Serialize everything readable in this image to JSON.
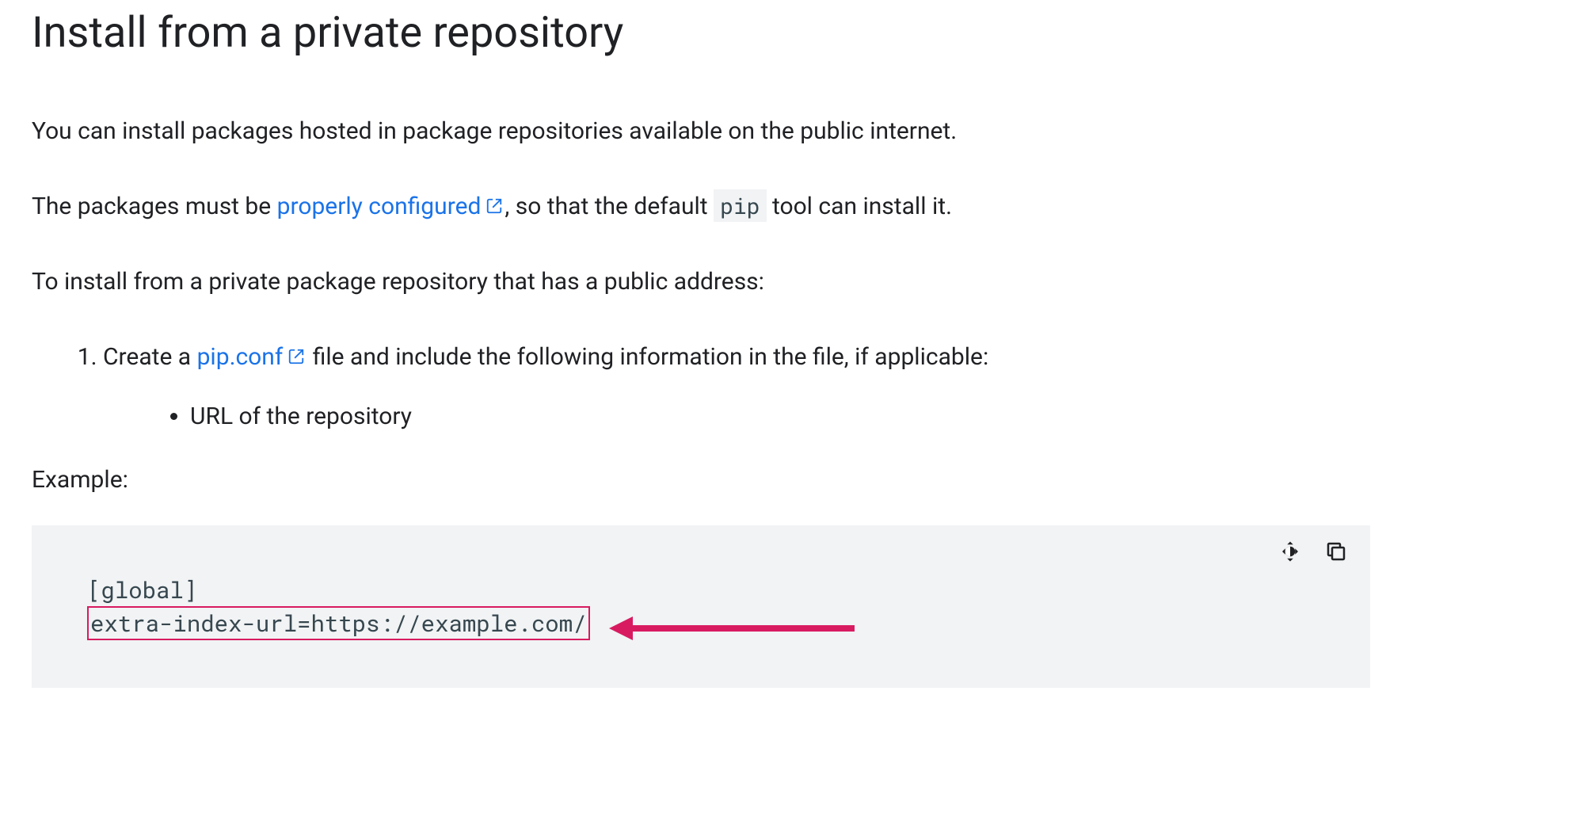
{
  "heading": "Install from a private repository",
  "para1": "You can install packages hosted in package repositories available on the public internet.",
  "para2_a": "The packages must be ",
  "para2_link": "properly configured",
  "para2_b": ", so that the default ",
  "para2_code": "pip",
  "para2_c": " tool can install it.",
  "para3": "To install from a private package repository that has a public address:",
  "step1_a": "Create a ",
  "step1_link": "pip.conf",
  "step1_b": " file and include the following information in the file, if applicable:",
  "step1_sub1": "URL of the repository",
  "example_label": "Example:",
  "code": {
    "line1": "[global]",
    "line2": "extra-index-url=https://example.com/"
  }
}
